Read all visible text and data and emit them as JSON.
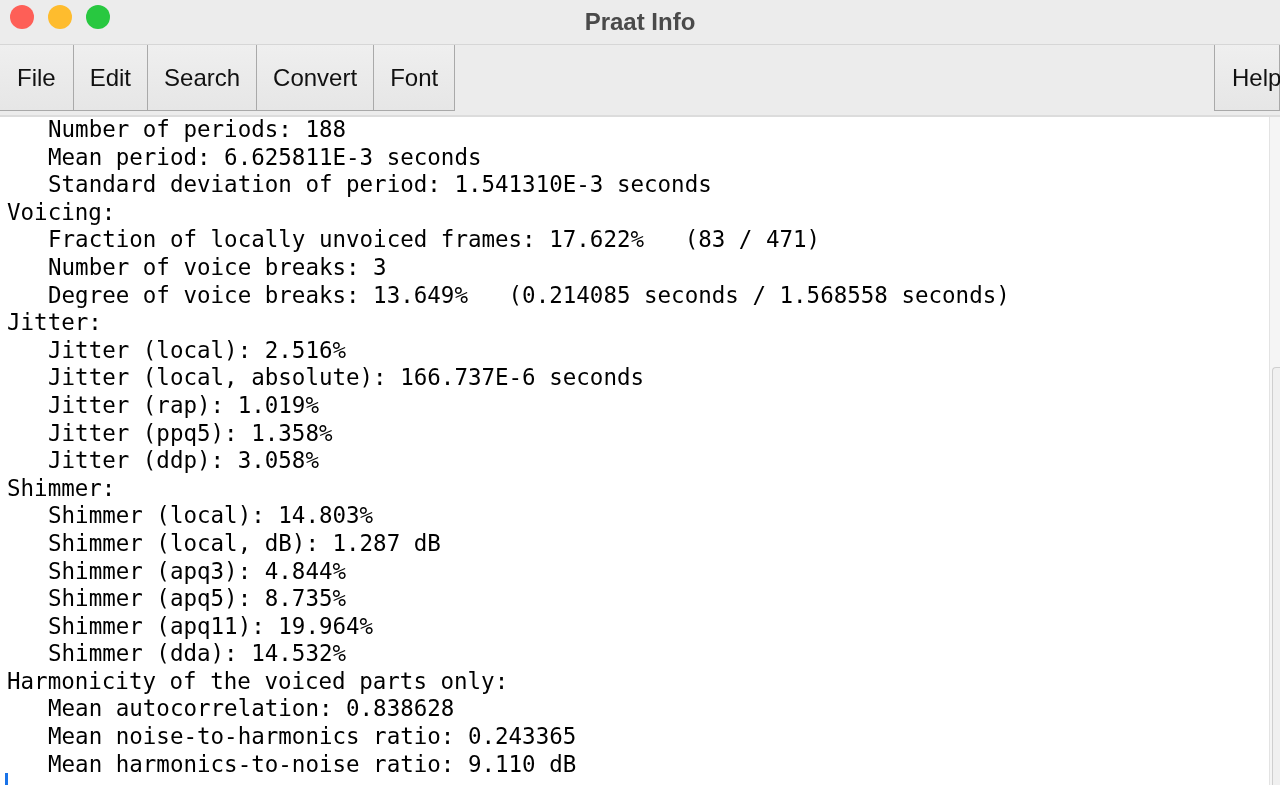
{
  "window": {
    "title": "Praat Info"
  },
  "menu": [
    {
      "label": "File"
    },
    {
      "label": "Edit"
    },
    {
      "label": "Search"
    },
    {
      "label": "Convert"
    },
    {
      "label": "Font"
    }
  ],
  "help_menu": {
    "label": "Help"
  },
  "lines": [
    {
      "kind": "item",
      "text": "Number of periods: 188"
    },
    {
      "kind": "item",
      "text": "Mean period: 6.625811E-3 seconds"
    },
    {
      "kind": "item",
      "text": "Standard deviation of period: 1.541310E-3 seconds"
    },
    {
      "kind": "heading",
      "text": "Voicing:"
    },
    {
      "kind": "item",
      "text": "Fraction of locally unvoiced frames: 17.622%   (83 / 471)"
    },
    {
      "kind": "item",
      "text": "Number of voice breaks: 3"
    },
    {
      "kind": "item",
      "text": "Degree of voice breaks: 13.649%   (0.214085 seconds / 1.568558 seconds)"
    },
    {
      "kind": "heading",
      "text": "Jitter:"
    },
    {
      "kind": "item",
      "text": "Jitter (local): 2.516%"
    },
    {
      "kind": "item",
      "text": "Jitter (local, absolute): 166.737E-6 seconds"
    },
    {
      "kind": "item",
      "text": "Jitter (rap): 1.019%"
    },
    {
      "kind": "item",
      "text": "Jitter (ppq5): 1.358%"
    },
    {
      "kind": "item",
      "text": "Jitter (ddp): 3.058%"
    },
    {
      "kind": "heading",
      "text": "Shimmer:"
    },
    {
      "kind": "item",
      "text": "Shimmer (local): 14.803%"
    },
    {
      "kind": "item",
      "text": "Shimmer (local, dB): 1.287 dB"
    },
    {
      "kind": "item",
      "text": "Shimmer (apq3): 4.844%"
    },
    {
      "kind": "item",
      "text": "Shimmer (apq5): 8.735%"
    },
    {
      "kind": "item",
      "text": "Shimmer (apq11): 19.964%"
    },
    {
      "kind": "item",
      "text": "Shimmer (dda): 14.532%"
    },
    {
      "kind": "heading",
      "text": "Harmonicity of the voiced parts only:"
    },
    {
      "kind": "item",
      "text": "Mean autocorrelation: 0.838628"
    },
    {
      "kind": "item",
      "text": "Mean noise-to-harmonics ratio: 0.243365"
    },
    {
      "kind": "item",
      "text": "Mean harmonics-to-noise ratio: 9.110 dB"
    }
  ]
}
